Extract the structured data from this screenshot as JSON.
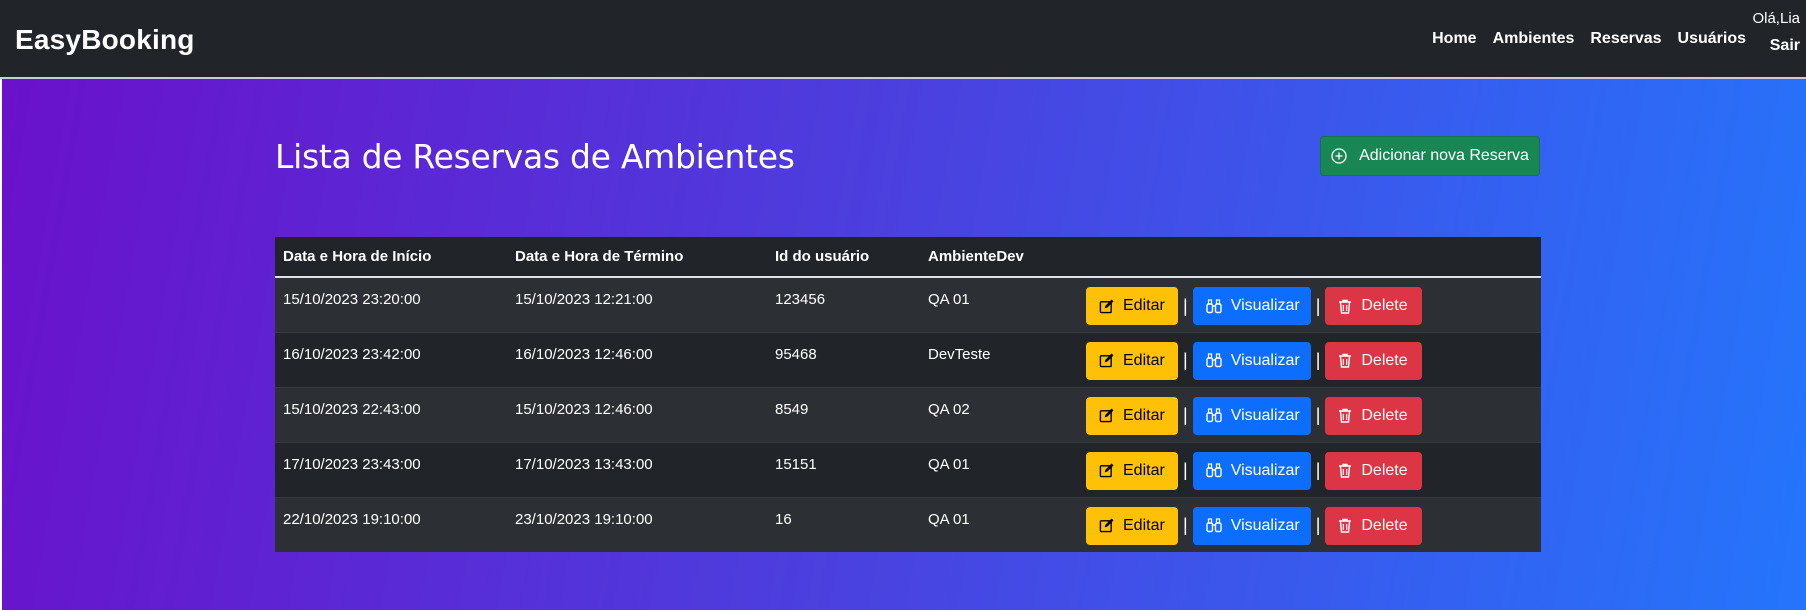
{
  "navbar": {
    "brand": "EasyBooking",
    "links": [
      "Home",
      "Ambientes",
      "Reservas",
      "Usuários"
    ],
    "greeting": "Olá,Lia",
    "logout": "Sair"
  },
  "page": {
    "title": "Lista de Reservas de Ambientes",
    "add_button": "Adicionar nova Reserva"
  },
  "table": {
    "headers": [
      "Data e Hora de Início",
      "Data e Hora de Término",
      "Id do usuário",
      "AmbienteDev",
      ""
    ],
    "actions": {
      "edit": "Editar",
      "view": "Visualizar",
      "delete": "Delete",
      "separator": "|"
    },
    "rows": [
      [
        "15/10/2023 23:20:00",
        "15/10/2023 12:21:00",
        "123456",
        "QA 01"
      ],
      [
        "16/10/2023 23:42:00",
        "16/10/2023 12:46:00",
        "95468",
        "DevTeste"
      ],
      [
        "15/10/2023 22:43:00",
        "15/10/2023 12:46:00",
        "8549",
        "QA 02"
      ],
      [
        "17/10/2023 23:43:00",
        "17/10/2023 13:43:00",
        "15151",
        "QA 01"
      ],
      [
        "22/10/2023 19:10:00",
        "23/10/2023 19:10:00",
        "16",
        "QA 01"
      ]
    ]
  },
  "icons": {
    "add": "plus-circle-icon",
    "edit": "pencil-square-icon",
    "view": "binoculars-icon",
    "delete": "trash-icon"
  },
  "colors": {
    "navbar": "#212529",
    "gradient_start": "#6a11cb",
    "gradient_end": "#2575fc",
    "success": "#198754",
    "warning": "#ffc107",
    "primary": "#0d6efd",
    "danger": "#dc3545"
  }
}
